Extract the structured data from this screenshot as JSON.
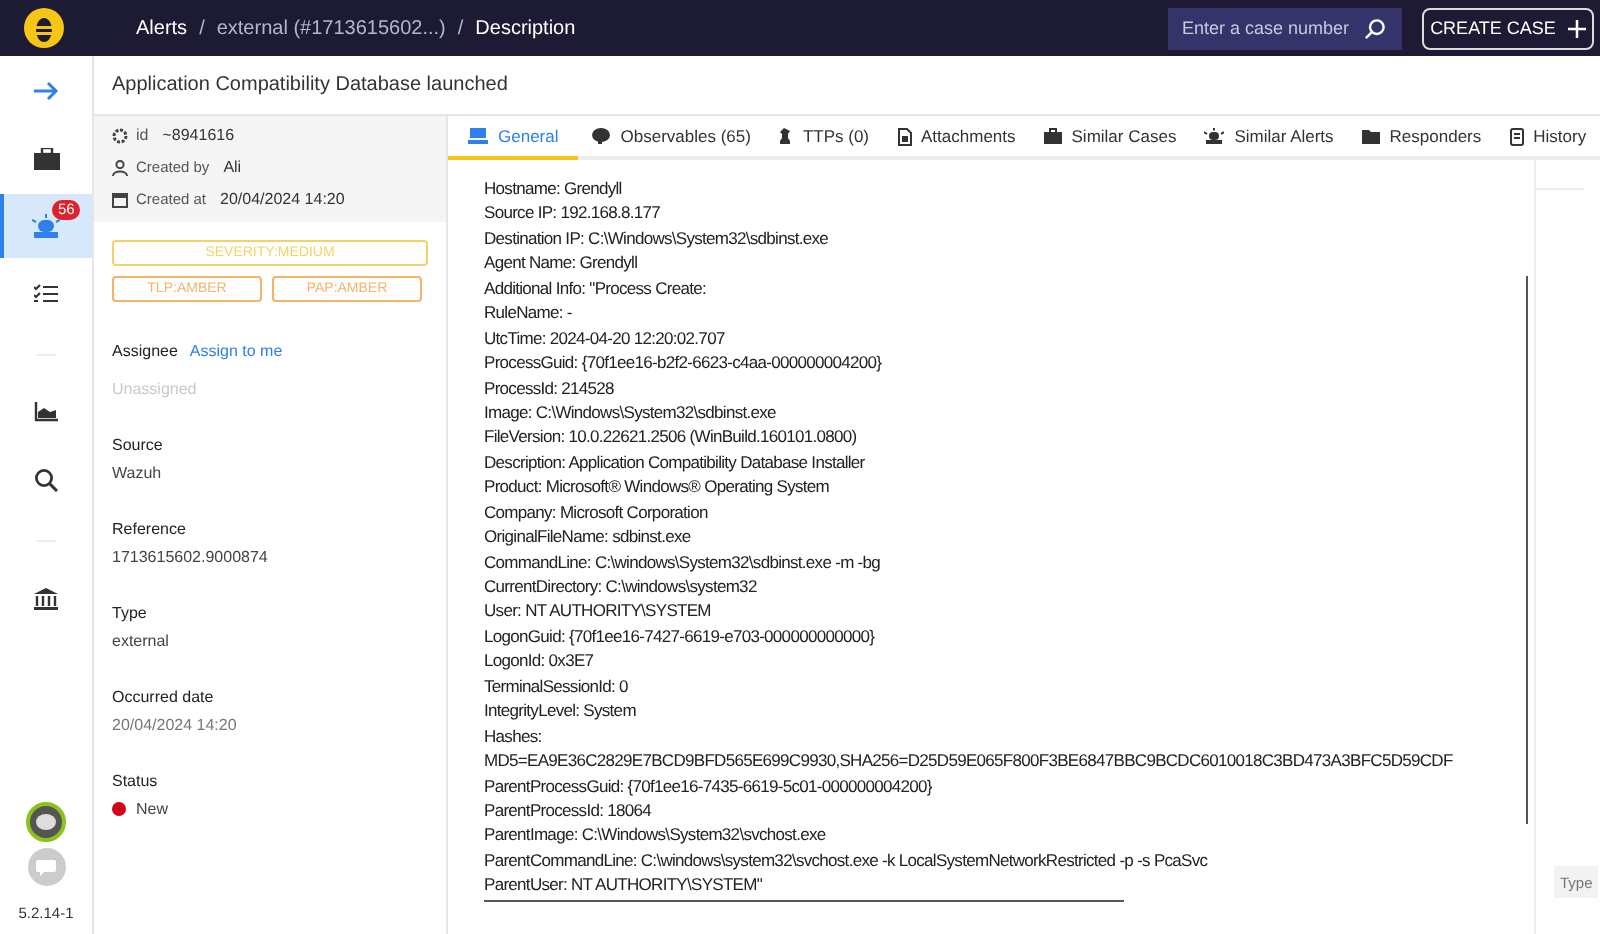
{
  "header": {
    "breadcrumbs": [
      "Alerts",
      "external (#1713615602...)",
      "Description"
    ],
    "separator": "/",
    "search": {
      "placeholder": "Enter a case number"
    },
    "create_button": "CREATE CASE"
  },
  "sidebar": {
    "items": [
      {
        "kind": "expand",
        "selected": false
      },
      {
        "kind": "cases",
        "selected": false
      },
      {
        "kind": "alerts",
        "selected": true,
        "badge": "56"
      },
      {
        "kind": "tasks",
        "selected": false
      },
      {
        "kind": "divider"
      },
      {
        "kind": "dashboards",
        "selected": false
      },
      {
        "kind": "search",
        "selected": false
      },
      {
        "kind": "divider"
      },
      {
        "kind": "organisation",
        "selected": false
      }
    ],
    "version": "5.2.14-1"
  },
  "alert": {
    "title": "Application Compatibility Database launched",
    "meta": [
      {
        "kind": "id",
        "label": "id",
        "value": "~8941616"
      },
      {
        "kind": "user",
        "label": "Created by",
        "value": "Ali"
      },
      {
        "kind": "date",
        "label": "Created at",
        "value": "20/04/2024 14:20"
      }
    ],
    "tags": [
      {
        "label": "SEVERITY:MEDIUM",
        "color": "#f2d36b"
      },
      {
        "label": "TLP:AMBER",
        "color": "#f5b26b"
      },
      {
        "label": "PAP:AMBER",
        "color": "#f5b26b"
      }
    ],
    "assignee": {
      "label": "Assignee",
      "link": "Assign to me",
      "value": "Unassigned"
    },
    "fields": [
      {
        "label": "Source",
        "value": "Wazuh",
        "muted": false
      },
      {
        "label": "Reference",
        "value": "1713615602.9000874",
        "muted": false
      },
      {
        "label": "Type",
        "value": "external",
        "muted": false
      },
      {
        "label": "Occurred date",
        "value": "20/04/2024 14:20",
        "muted": true
      }
    ],
    "status": {
      "label": "Status",
      "value": "New",
      "color": "#d0021b"
    }
  },
  "tabs": [
    {
      "kind": "general",
      "label": "General",
      "selected": true
    },
    {
      "kind": "observables",
      "label": "Observables (65)",
      "selected": false
    },
    {
      "kind": "ttps",
      "label": "TTPs (0)",
      "selected": false
    },
    {
      "kind": "attachments",
      "label": "Attachments",
      "selected": false
    },
    {
      "kind": "cases",
      "label": "Similar Cases",
      "selected": false
    },
    {
      "kind": "alerts",
      "label": "Similar Alerts",
      "selected": false
    },
    {
      "kind": "responders",
      "label": "Responders",
      "selected": false
    },
    {
      "kind": "history",
      "label": "History",
      "selected": false
    }
  ],
  "description": [
    "Hostname: Grendyll",
    "Source IP: 192.168.8.177",
    "Destination IP: C:\\Windows\\System32\\sdbinst.exe",
    "Agent Name: Grendyll",
    "Additional Info: \"Process Create:",
    "RuleName: -",
    "UtcTime: 2024-04-20 12:20:02.707",
    "ProcessGuid: {70f1ee16-b2f2-6623-c4aa-000000004200}",
    "ProcessId: 214528",
    "Image: C:\\Windows\\System32\\sdbinst.exe",
    "FileVersion: 10.0.22621.2506 (WinBuild.160101.0800)",
    "Description: Application Compatibility Database Installer",
    "Product: Microsoft® Windows® Operating System",
    "Company: Microsoft Corporation",
    "OriginalFileName: sdbinst.exe",
    "CommandLine: C:\\windows\\System32\\sdbinst.exe -m -bg",
    "CurrentDirectory: C:\\windows\\system32",
    "User: NT AUTHORITY\\SYSTEM",
    "LogonGuid: {70f1ee16-7427-6619-e703-000000000000}",
    "LogonId: 0x3E7",
    "TerminalSessionId: 0",
    "IntegrityLevel: System",
    "Hashes:",
    "MD5=EA9E36C2829E7BCD9BFD565E699C9930,SHA256=D25D59E065F800F3BE6847BBC9BCDC6010018C3BD473A3BFC5D59CDF",
    "ParentProcessGuid: {70f1ee16-7435-6619-5c01-000000004200}",
    "ParentProcessId: 18064",
    "ParentImage: C:\\Windows\\System32\\svchost.exe",
    "ParentCommandLine: C:\\windows\\system32\\svchost.exe -k LocalSystemNetworkRestricted -p -s PcaSvc",
    "ParentUser: NT AUTHORITY\\SYSTEM\""
  ],
  "chat": {
    "placeholder": "Type"
  }
}
